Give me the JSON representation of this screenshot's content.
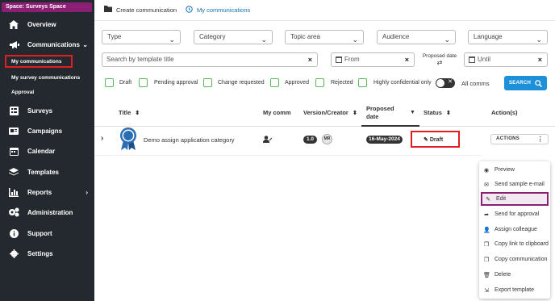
{
  "sidebar": {
    "space_label": "Space: Surveys Space",
    "items": [
      {
        "label": "Overview",
        "icon": "home-icon"
      },
      {
        "label": "Communications",
        "icon": "megaphone-icon"
      },
      {
        "label": "Surveys",
        "icon": "survey-icon"
      },
      {
        "label": "Campaigns",
        "icon": "campaign-icon"
      },
      {
        "label": "Calendar",
        "icon": "calendar-icon"
      },
      {
        "label": "Templates",
        "icon": "layers-icon"
      },
      {
        "label": "Reports",
        "icon": "chart-icon"
      },
      {
        "label": "Administration",
        "icon": "cogs-icon"
      },
      {
        "label": "Support",
        "icon": "info-icon"
      },
      {
        "label": "Settings",
        "icon": "gear-icon"
      }
    ],
    "sub_items": [
      "My communications",
      "My survey communications",
      "Approval"
    ]
  },
  "topbar": {
    "create_label": "Create communication",
    "my_label": "My communications"
  },
  "filters": {
    "type": "Type",
    "category": "Category",
    "topic_area": "Topic area",
    "audience": "Audience",
    "language": "Language",
    "search_placeholder": "Search by template title",
    "from": "From",
    "proposed_date": "Proposed date",
    "until": "Until",
    "checkboxes": [
      "Draft",
      "Pending approval",
      "Change requested",
      "Approved",
      "Rejected",
      "Highly confidential only"
    ],
    "toggle_text": "✕",
    "all_comms": "All comms",
    "search_button": "SEARCH"
  },
  "table": {
    "headers": {
      "title": "Title",
      "my_comm": "My comm",
      "version_creator": "Version/Creator",
      "proposed_date_1": "Proposed",
      "proposed_date_2": "date",
      "status": "Status",
      "actions": "Action(s)"
    },
    "row": {
      "title": "Demo assign application category",
      "version": "1.0",
      "creator": "MR",
      "proposed_date": "16-May-2024",
      "status": "Draft",
      "actions_label": "ACTIONS"
    }
  },
  "menu": {
    "items": [
      {
        "label": "Preview",
        "icon": "eye-icon"
      },
      {
        "label": "Send sample e-mail",
        "icon": "envelope-icon"
      },
      {
        "label": "Edit",
        "icon": "pencil-icon"
      },
      {
        "label": "Send for approval",
        "icon": "send-icon"
      },
      {
        "label": "Assign colleague",
        "icon": "user-plus-icon"
      },
      {
        "label": "Copy link to clipboard",
        "icon": "copy-icon"
      },
      {
        "label": "Copy communication",
        "icon": "copy-icon"
      },
      {
        "label": "Delete",
        "icon": "trash-icon"
      },
      {
        "label": "Export template",
        "icon": "export-icon"
      }
    ]
  },
  "colors": {
    "sidebar_bg": "#23292e",
    "brand": "#8b1f74",
    "accent_blue": "#1e90d9",
    "checkbox_green": "#5cb85c",
    "highlight_red": "#e02020"
  }
}
